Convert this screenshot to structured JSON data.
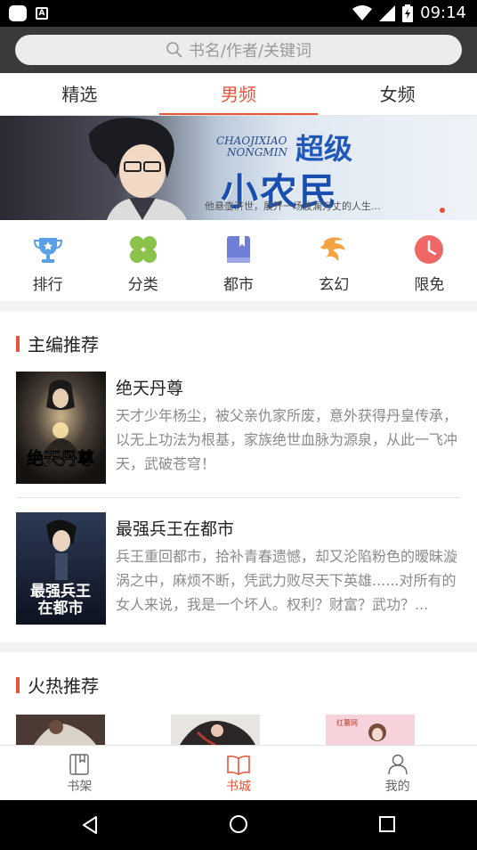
{
  "status_bar": {
    "time": "09:14"
  },
  "search": {
    "placeholder": "书名/作者/关键词"
  },
  "tabs": [
    {
      "label": "精选",
      "active": false
    },
    {
      "label": "男频",
      "active": true
    },
    {
      "label": "女频",
      "active": false
    }
  ],
  "banner": {
    "title_en_1": "CHAOJIXIAO",
    "title_en_2": "NONGMIN",
    "title_a": "超级",
    "title_b": "小农民",
    "caption": "他悬壶济世，展开一场波澜万丈的人生..."
  },
  "categories": [
    {
      "label": "排行",
      "icon": "trophy-icon",
      "color": "#5aa0e8"
    },
    {
      "label": "分类",
      "icon": "clover-icon",
      "color": "#8bc34a"
    },
    {
      "label": "都市",
      "icon": "book-icon",
      "color": "#6f7fd8"
    },
    {
      "label": "玄幻",
      "icon": "dragon-icon",
      "color": "#f4a340"
    },
    {
      "label": "限免",
      "icon": "clock-icon",
      "color": "#f06767"
    }
  ],
  "section_editor": {
    "title": "主编推荐",
    "books": [
      {
        "title": "绝天丹尊",
        "cover_text": "绝天丹尊",
        "desc": "天才少年杨尘，被父亲仇家所废，意外获得丹皇传承，以无上功法为根基，家族绝世血脉为源泉，从此一飞冲天，武破苍穹！"
      },
      {
        "title": "最强兵王在都市",
        "cover_text": "最强兵王在都市",
        "desc": "兵王重回都市，拾补青春遗憾，却又沦陷粉色的暧昧漩涡之中，麻烦不断，凭武力败尽天下英雄......对所有的女人来说，我是一个坏人。权利？财富？武功？..."
      }
    ]
  },
  "section_hot": {
    "title": "火热推荐"
  },
  "bottom_nav": [
    {
      "label": "书架",
      "icon": "bookshelf-icon",
      "active": false
    },
    {
      "label": "书城",
      "icon": "open-book-icon",
      "active": true
    },
    {
      "label": "我的",
      "icon": "person-icon",
      "active": false
    }
  ],
  "colors": {
    "accent": "#e8543a",
    "text_secondary": "#8a8a8a"
  }
}
